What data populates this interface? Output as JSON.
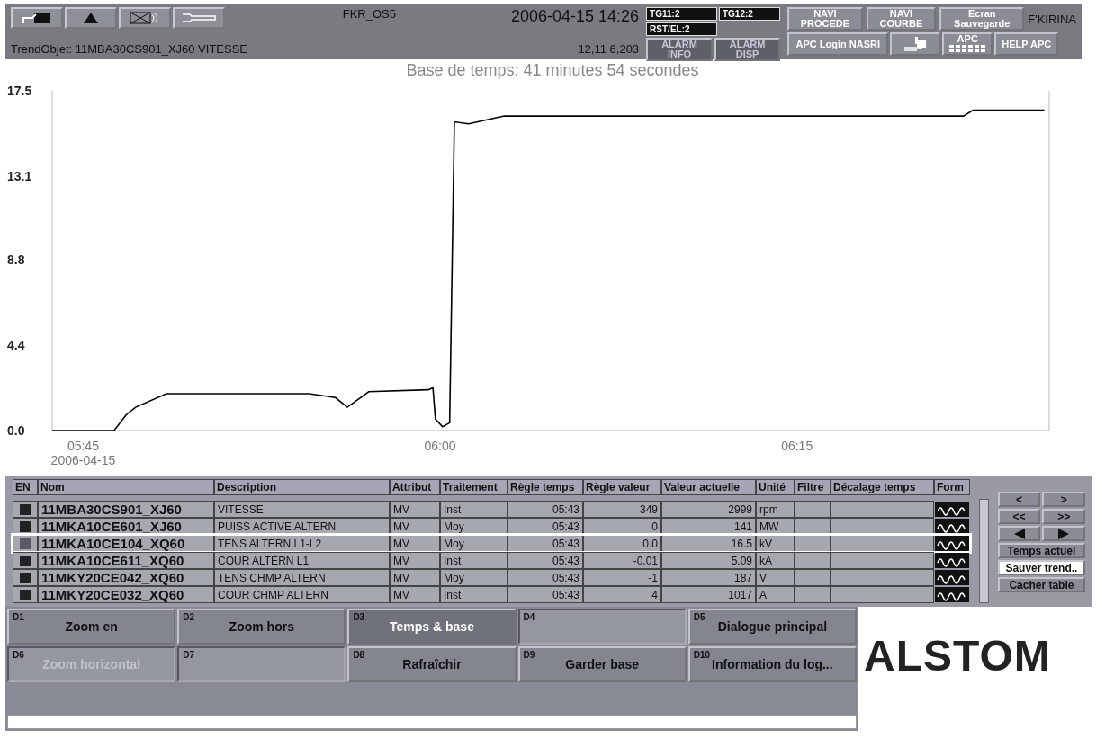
{
  "top_bar": {
    "station": "FKR_OS5",
    "datetime": "2006-04-15  14:26",
    "trend_object": "TrendObjet: 11MBA30CS901_XJ60 VITESSE",
    "cursor_values": "12,11   6,203",
    "user": "F'KIRINA",
    "icon_buttons": [
      {
        "kind": "window"
      },
      {
        "kind": "triangle"
      },
      {
        "kind": "mute"
      },
      {
        "kind": "wrench"
      }
    ],
    "status_tags": [
      "TG11:2",
      "TG12:2",
      "RST/EL:2"
    ],
    "alarm_buttons": [
      {
        "label": "ALARM INFO",
        "disabled": true
      },
      {
        "label": "ALARM DISP",
        "disabled": true
      }
    ],
    "nav_buttons": [
      {
        "label": "NAVI PROCEDE"
      },
      {
        "label": "NAVI COURBE"
      },
      {
        "label": "Ecran Sauvegarde"
      }
    ],
    "tool_buttons": [
      {
        "kind": "login",
        "label": "APC Login NASRI"
      },
      {
        "kind": "display"
      },
      {
        "kind": "keyboard",
        "label": "APC"
      },
      {
        "kind": "text",
        "label": "HELP APC"
      }
    ]
  },
  "chart": {
    "chart_data": {
      "type": "line",
      "title": "Base de temps: 41 minutes 54 secondes",
      "xlim": [
        5.7283,
        6.4267
      ],
      "ylim": [
        0,
        17.5
      ],
      "xticks": [
        {
          "value": 5.75,
          "label": "05:45"
        },
        {
          "value": 6,
          "label": "06:00"
        },
        {
          "value": 6.25,
          "label": "06:15"
        }
      ],
      "yticks": [
        {
          "value": 0,
          "label": "0.0"
        },
        {
          "value": 4.4,
          "label": "4.4"
        },
        {
          "value": 8.8,
          "label": "8.8"
        },
        {
          "value": 13.1,
          "label": "13.1"
        },
        {
          "value": 17.5,
          "label": "17.5"
        }
      ],
      "x": [
        5.7283,
        5.7717,
        5.78,
        5.7867,
        5.8083,
        5.9083,
        5.9267,
        5.935,
        5.95,
        5.9917,
        5.995,
        5.9967,
        6.0017,
        6.0067,
        6.01,
        6.02,
        6.045,
        6.3667,
        6.3733,
        6.4233
      ],
      "series": [
        {
          "color": "#000000",
          "values": [
            0,
            0,
            0.8,
            1.2,
            1.9,
            1.9,
            1.7,
            1.2,
            2.0,
            2.1,
            2.2,
            0.6,
            0.2,
            0.4,
            15.9,
            15.8,
            16.2,
            16.2,
            16.5,
            16.5
          ]
        }
      ]
    },
    "date_label": "2006-04-15"
  },
  "table": {
    "columns": [
      "EN",
      "Nom",
      "Description",
      "Attribut",
      "Traitement",
      "Règle temps",
      "Règle valeur",
      "Valeur actuelle",
      "Unité",
      "Filtre",
      "Décalage temps",
      "Form"
    ],
    "rows": [
      {
        "name": "11MBA30CS901_XJ60",
        "description": "VITESSE",
        "attribut": "MV",
        "traitement": "Inst",
        "regle_temps": "05:43",
        "regle_valeur": "349",
        "valeur": "2999",
        "unite": "rpm",
        "selected": false
      },
      {
        "name": "11MKA10CE601_XJ60",
        "description": "PUISS ACTIVE ALTERN",
        "attribut": "MV",
        "traitement": "Moy",
        "regle_temps": "05:43",
        "regle_valeur": "0",
        "valeur": "141",
        "unite": "MW",
        "selected": false
      },
      {
        "name": "11MKA10CE104_XQ60",
        "description": "TENS ALTERN L1-L2",
        "attribut": "MV",
        "traitement": "Moy",
        "regle_temps": "05:43",
        "regle_valeur": "0.0",
        "valeur": "16.5",
        "unite": "kV",
        "selected": true
      },
      {
        "name": "11MKA10CE611_XQ60",
        "description": "COUR ALTERN L1",
        "attribut": "MV",
        "traitement": "Inst",
        "regle_temps": "05:43",
        "regle_valeur": "-0.01",
        "valeur": "5.09",
        "unite": "kA",
        "selected": false
      },
      {
        "name": "11MKY20CE042_XQ60",
        "description": "TENS CHMP ALTERN",
        "attribut": "MV",
        "traitement": "Moy",
        "regle_temps": "05:43",
        "regle_valeur": "-1",
        "valeur": "187",
        "unite": "V",
        "selected": false
      },
      {
        "name": "11MKY20CE032_XQ60",
        "description": "COUR CHMP ALTERN",
        "attribut": "MV",
        "traitement": "Inst",
        "regle_temps": "05:43",
        "regle_valeur": "4",
        "valeur": "1017",
        "unite": "A",
        "selected": false
      }
    ]
  },
  "nav_panel": {
    "arrows": [
      "<",
      ">",
      "<<",
      ">>"
    ],
    "buttons": [
      {
        "label": "Temps actuel",
        "highlighted": false
      },
      {
        "label": "Sauver trend..",
        "highlighted": true
      },
      {
        "label": "Cacher table",
        "highlighted": false
      }
    ]
  },
  "function_keys": [
    {
      "key": "D1",
      "label": "Zoom en",
      "disabled": false,
      "highlighted": false
    },
    {
      "key": "D2",
      "label": "Zoom hors",
      "disabled": false,
      "highlighted": false
    },
    {
      "key": "D3",
      "label": "Temps & base",
      "disabled": false,
      "highlighted": true
    },
    {
      "key": "D4",
      "disabled": true,
      "highlighted": false
    },
    {
      "key": "D5",
      "label": "Dialogue principal",
      "disabled": false,
      "highlighted": false
    },
    {
      "key": "D6",
      "label": "Zoom horizontal",
      "disabled": true,
      "highlighted": false
    },
    {
      "key": "D7",
      "disabled": true,
      "highlighted": false
    },
    {
      "key": "D8",
      "label": "Rafraîchir",
      "disabled": false,
      "highlighted": false
    },
    {
      "key": "D9",
      "label": "Garder base",
      "disabled": false,
      "highlighted": false
    },
    {
      "key": "D10",
      "label": "Information du log...",
      "disabled": false,
      "highlighted": false
    }
  ],
  "logo": "ALSTOM"
}
